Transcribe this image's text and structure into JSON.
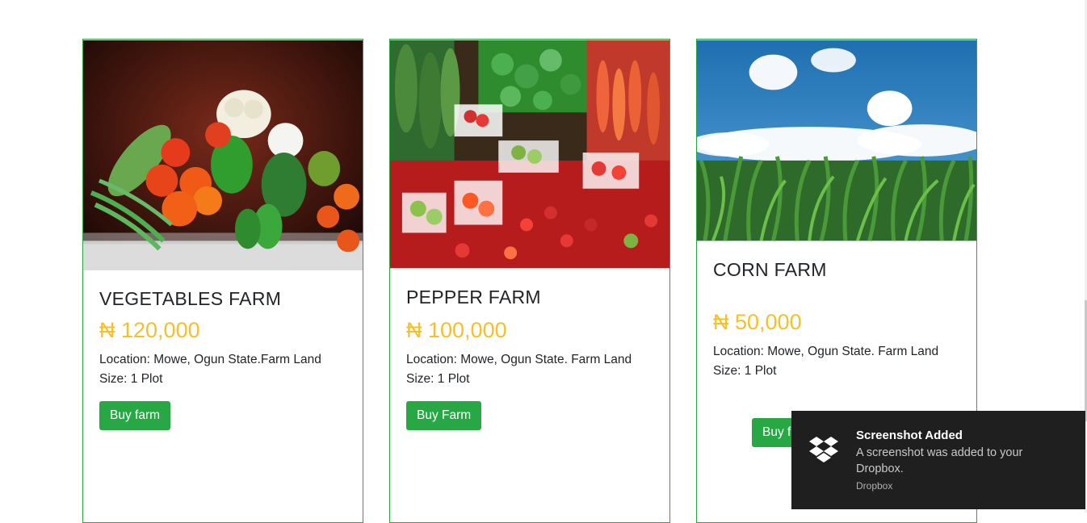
{
  "farms": [
    {
      "title": "VEGETABLES FARM",
      "price": "₦ 120,000",
      "location": "Location: Mowe, Ogun State.Farm Land",
      "size": "Size: 1 Plot",
      "button": "Buy farm"
    },
    {
      "title": "PEPPER FARM",
      "price": "₦ 100,000",
      "location": "Location: Mowe, Ogun State. Farm Land",
      "size": "Size: 1 Plot",
      "button": "Buy Farm"
    },
    {
      "title": "CORN FARM",
      "price": "₦ 50,000",
      "location": "Location: Mowe, Ogun State. Farm Land",
      "size": "Size: 1 Plot",
      "button": "Buy f"
    }
  ],
  "toast": {
    "title": "Screenshot Added",
    "body": "A screenshot was added to your Dropbox.",
    "source": "Dropbox",
    "icon": "dropbox-icon"
  },
  "colors": {
    "accent": "#28a745",
    "price": "#f5c02a",
    "toast_bg": "#1f1f1f"
  }
}
